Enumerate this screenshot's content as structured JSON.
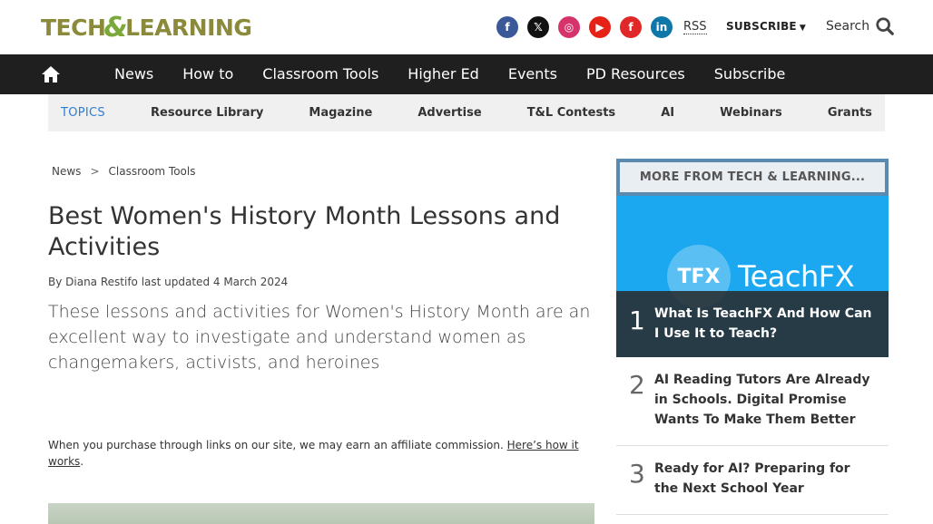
{
  "header": {
    "logo_left": "TECH",
    "logo_amp": "&",
    "logo_right": "LEARNING",
    "social": [
      {
        "name": "facebook-icon",
        "glyph": "f",
        "color": "#3b5998"
      },
      {
        "name": "x-icon",
        "glyph": "𝕏",
        "color": "#111111"
      },
      {
        "name": "instagram-icon",
        "glyph": "◎",
        "color": "#d6336c"
      },
      {
        "name": "youtube-icon",
        "glyph": "▶",
        "color": "#e62117"
      },
      {
        "name": "flipboard-icon",
        "glyph": "f",
        "color": "#e12828"
      },
      {
        "name": "linkedin-icon",
        "glyph": "in",
        "color": "#0e76a8"
      }
    ],
    "rss_label": "RSS",
    "subscribe_label": "SUBSCRIBE",
    "search_label": "Search"
  },
  "nav": {
    "items": [
      "News",
      "How to",
      "Classroom Tools",
      "Higher Ed",
      "Events",
      "PD Resources",
      "Subscribe"
    ]
  },
  "topics": {
    "label": "TOPICS",
    "items": [
      "Resource Library",
      "Magazine",
      "Advertise",
      "T&L Contests",
      "AI",
      "Webinars",
      "Grants"
    ]
  },
  "breadcrumb": {
    "items": [
      "News",
      "Classroom Tools"
    ],
    "separator": ">"
  },
  "article": {
    "title": "Best Women's History Month Lessons and Activities",
    "byline": "By Diana Restifo last updated 4 March 2024",
    "strapline": "These lessons and activities for Women's History Month are an excellent way to investigate and understand women as changemakers, activists, and heroines",
    "affiliate_text": "When you purchase through links on our site, we may earn an affiliate commission.",
    "affiliate_link": "Here’s how it works",
    "affiliate_end": "."
  },
  "sidebar": {
    "heading": "MORE FROM TECH & LEARNING...",
    "feature_logo_circle": "TFX",
    "feature_logo_word": "TeachFX",
    "items": [
      {
        "rank": "1",
        "title": "What Is TeachFX And How Can I Use It to Teach?"
      },
      {
        "rank": "2",
        "title": "AI Reading Tutors Are Already in Schools. Digital Promise Wants To Make Them Better"
      },
      {
        "rank": "3",
        "title": "Ready for AI? Preparing for the Next School Year"
      }
    ]
  }
}
